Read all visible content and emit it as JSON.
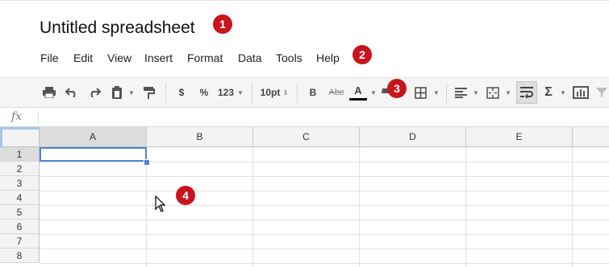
{
  "document": {
    "title": "Untitled spreadsheet"
  },
  "menu": {
    "items": [
      {
        "id": "file",
        "label": "File"
      },
      {
        "id": "edit",
        "label": "Edit"
      },
      {
        "id": "view",
        "label": "View"
      },
      {
        "id": "insert",
        "label": "Insert"
      },
      {
        "id": "format",
        "label": "Format"
      },
      {
        "id": "data",
        "label": "Data"
      },
      {
        "id": "tools",
        "label": "Tools"
      },
      {
        "id": "help",
        "label": "Help"
      }
    ]
  },
  "toolbar": {
    "currency_label": "$",
    "percent_label": "%",
    "number_format_label": "123",
    "font_size_label": "10pt",
    "bold_label": "B",
    "strikethrough_label": "Abc",
    "text_color_label": "A",
    "sum_label": "Σ",
    "text_color_value": "#000000"
  },
  "formula_bar": {
    "fx_label": "fx",
    "value": ""
  },
  "grid": {
    "columns": [
      "A",
      "B",
      "C",
      "D",
      "E"
    ],
    "rows": [
      "1",
      "2",
      "3",
      "4",
      "5",
      "6",
      "7",
      "8"
    ],
    "selected_cell": "A1"
  },
  "callouts": [
    "1",
    "2",
    "3",
    "4"
  ],
  "colors": {
    "accent": "#4a87d6",
    "callout": "#c8141c"
  }
}
